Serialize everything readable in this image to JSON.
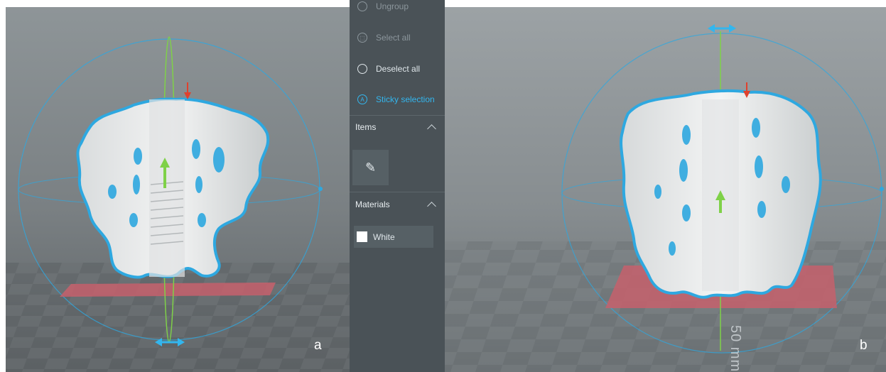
{
  "side_panel": {
    "menu": [
      {
        "label": "Ungroup",
        "icon": "ungroup-icon",
        "state": "disabled"
      },
      {
        "label": "Select all",
        "icon": "select-all-icon",
        "state": "disabled"
      },
      {
        "label": "Deselect all",
        "icon": "deselect-all-icon",
        "state": "enabled"
      },
      {
        "label": "Sticky selection",
        "icon": "sticky-selection-icon",
        "state": "active"
      }
    ],
    "items_section": {
      "title": "Items",
      "expanded": true,
      "tile_icon": "model-item-icon"
    },
    "materials_section": {
      "title": "Materials",
      "expanded": true,
      "material": {
        "name": "White",
        "color": "#ffffff"
      }
    }
  },
  "viewport_a": {
    "label": "a"
  },
  "viewport_b": {
    "label": "b",
    "scale_text": "50 mm"
  },
  "colors": {
    "selection_outline": "#2ea8e0",
    "gizmo_green": "#7fd148",
    "gizmo_red": "#e0412d",
    "build_plate": "#c6606c",
    "panel_bg": "#4a5257",
    "accent": "#33b6ee"
  }
}
